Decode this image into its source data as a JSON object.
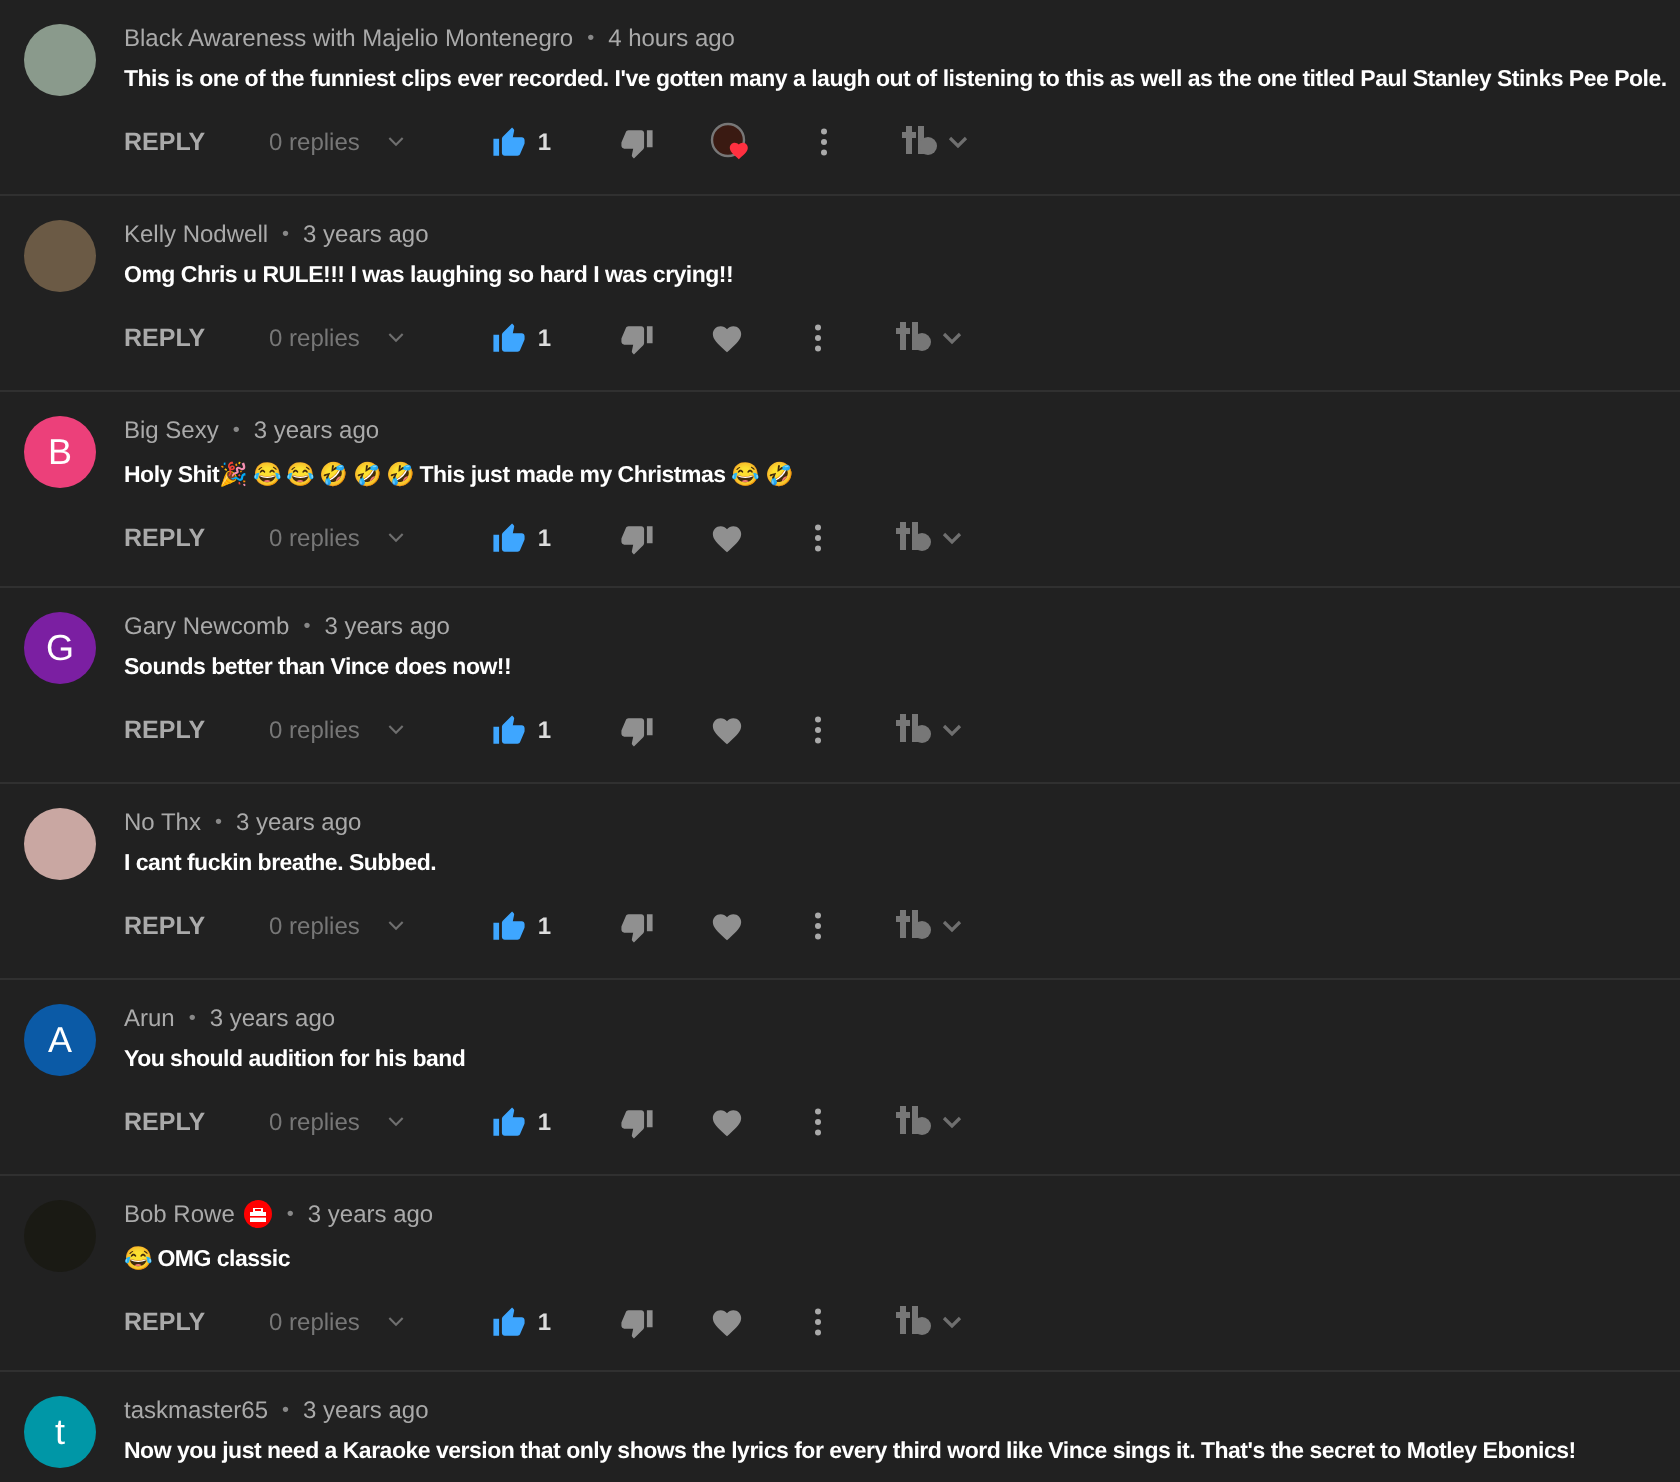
{
  "comments": [
    {
      "author": "Black Awareness with Majelio Montenegro",
      "separator": "•",
      "time": "4 hours ago",
      "text": "This is one of the funniest clips ever recorded. I've gotten many a laugh out of listening to this as well as the one titled Paul Stanley Stinks Pee Pole.",
      "avatar": {
        "kind": "photo",
        "color": "#8a9a8c"
      },
      "reply": "REPLY",
      "replies": "0 replies",
      "liked": true,
      "likes": "1",
      "creator_heart": true
    },
    {
      "author": "Kelly Nodwell",
      "separator": "•",
      "time": "3 years ago",
      "text": "Omg Chris u RULE!!! I was laughing so hard I was crying!!",
      "avatar": {
        "kind": "photo",
        "color": "#6b5a45"
      },
      "reply": "REPLY",
      "replies": "0 replies",
      "liked": true,
      "likes": "1",
      "creator_heart": false
    },
    {
      "author": "Big Sexy",
      "separator": "•",
      "time": "3 years ago",
      "text": "Holy Shit🎉 😂 😂 🤣 🤣 🤣 This just made my Christmas 😂 🤣",
      "avatar": {
        "kind": "letter",
        "letter": "B",
        "color": "#ec407a"
      },
      "reply": "REPLY",
      "replies": "0 replies",
      "liked": true,
      "likes": "1",
      "creator_heart": false
    },
    {
      "author": "Gary Newcomb",
      "separator": "•",
      "time": "3 years ago",
      "text": "Sounds better than Vince does now!!",
      "avatar": {
        "kind": "letter",
        "letter": "G",
        "color": "#7b1fa2"
      },
      "reply": "REPLY",
      "replies": "0 replies",
      "liked": true,
      "likes": "1",
      "creator_heart": false
    },
    {
      "author": "No Thx",
      "separator": "•",
      "time": "3 years ago",
      "text": "I cant fuckin breathe.  Subbed.",
      "avatar": {
        "kind": "photo",
        "color": "#c9a7a2"
      },
      "reply": "REPLY",
      "replies": "0 replies",
      "liked": true,
      "likes": "1",
      "creator_heart": false
    },
    {
      "author": "Arun",
      "separator": "•",
      "time": "3 years ago",
      "text": "You should audition for his band",
      "avatar": {
        "kind": "letter",
        "letter": "A",
        "color": "#0b5aa6"
      },
      "reply": "REPLY",
      "replies": "0 replies",
      "liked": true,
      "likes": "1",
      "creator_heart": false
    },
    {
      "author": "Bob Rowe",
      "badge": true,
      "separator": "•",
      "time": "3 years ago",
      "text": "😂 OMG classic",
      "avatar": {
        "kind": "photo",
        "color": "#1a1a14"
      },
      "reply": "REPLY",
      "replies": "0 replies",
      "liked": true,
      "likes": "1",
      "creator_heart": false
    },
    {
      "author": "taskmaster65",
      "separator": "•",
      "time": "3 years ago",
      "text": "Now you just need a Karaoke version that only shows the lyrics for every third word like Vince sings it. That's the secret to Motley Ebonics!",
      "avatar": {
        "kind": "letter",
        "letter": "t",
        "color": "#0097a7"
      }
    }
  ]
}
